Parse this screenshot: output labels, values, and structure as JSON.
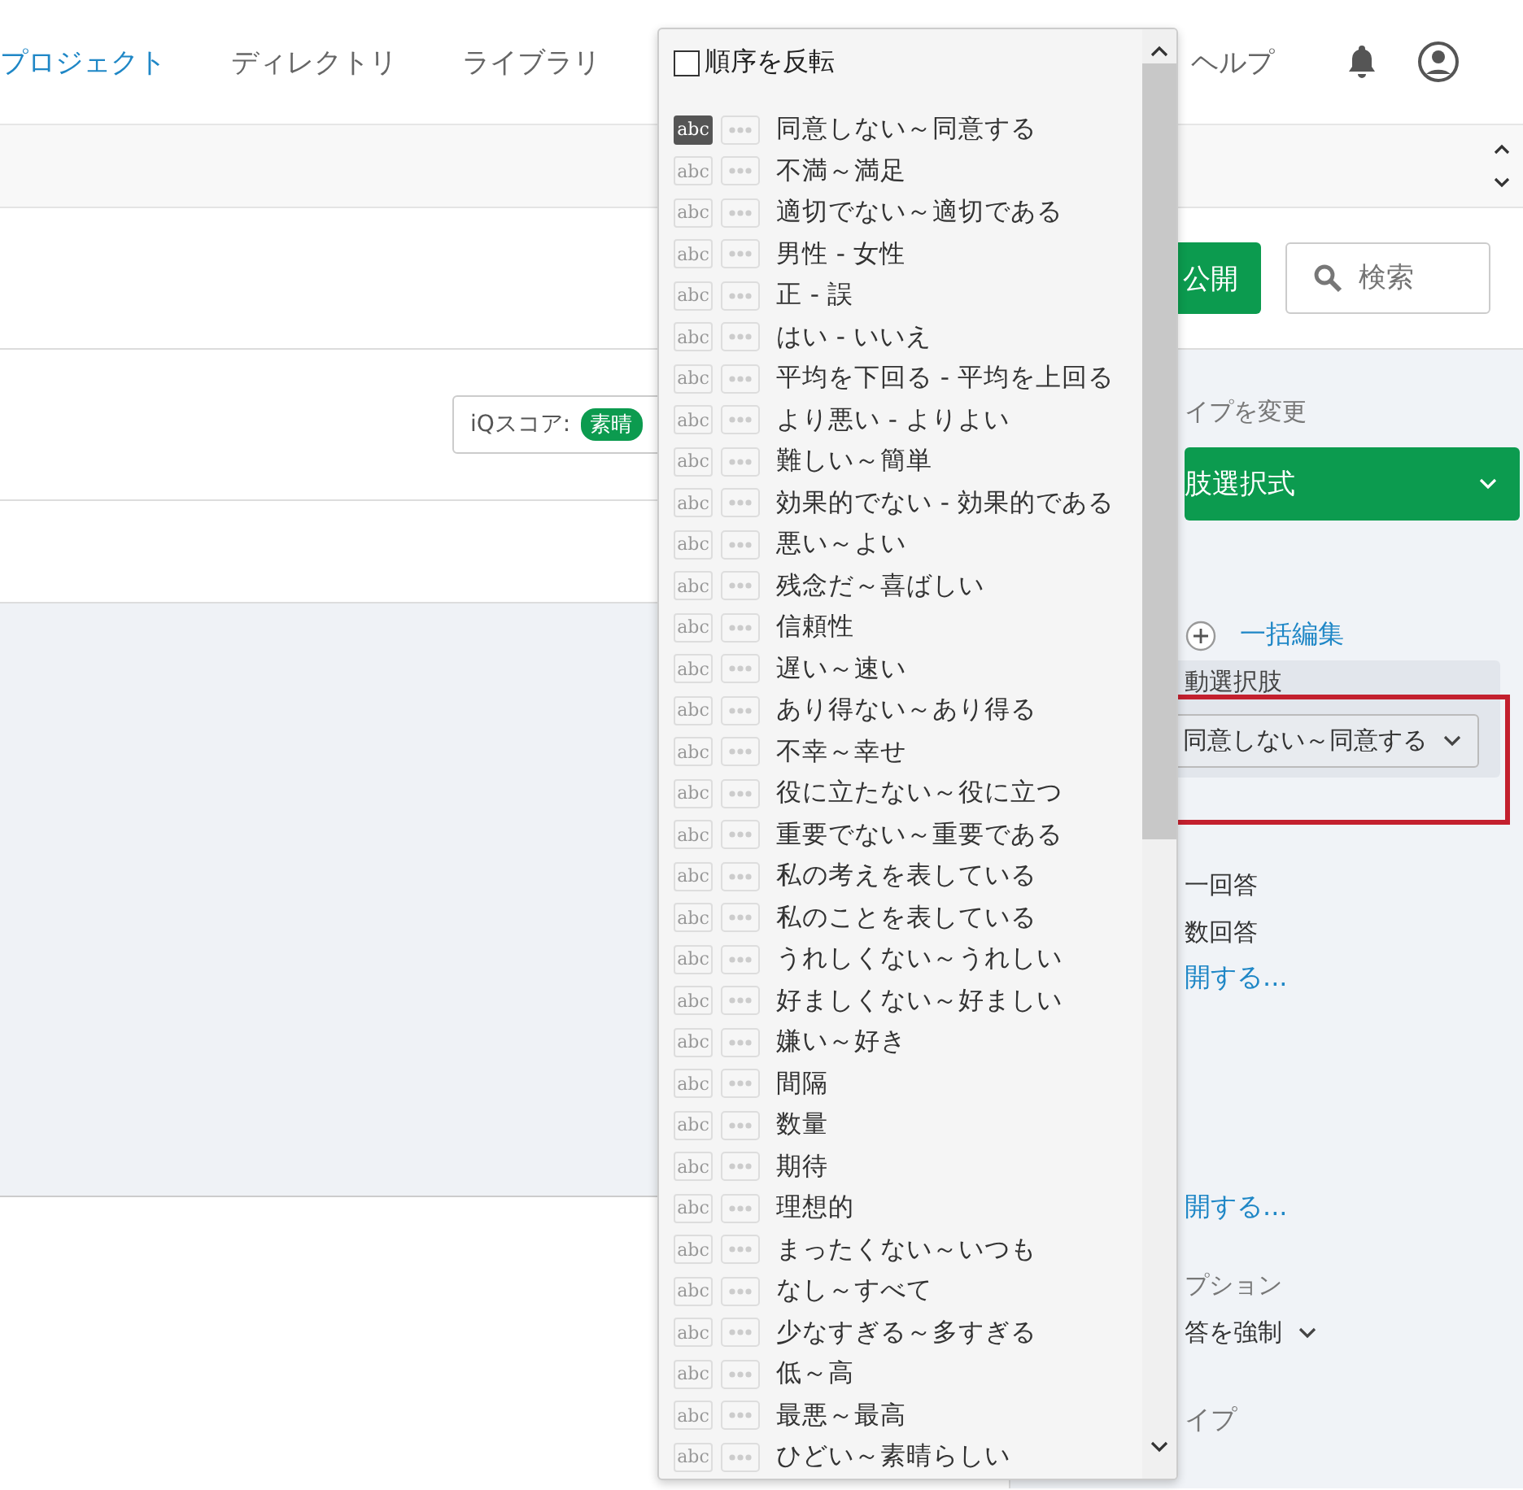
{
  "nav": {
    "items": [
      {
        "label": "プロジェクト",
        "selected": true
      },
      {
        "label": "ディレクトリ",
        "selected": false
      },
      {
        "label": "ライブラリ",
        "selected": false
      }
    ],
    "help": "ヘルプ"
  },
  "toolbar": {
    "publish": "公開",
    "search": {
      "placeholder": "検索"
    }
  },
  "iq": {
    "label": "iQスコア:",
    "badge": "素晴"
  },
  "dropdown": {
    "reverse": {
      "label": "順序を反転",
      "checked": false
    },
    "items": [
      {
        "tag": "abc",
        "label": "同意しない～同意する",
        "selected": true
      },
      {
        "tag": "abc",
        "label": "不満～満足",
        "selected": false
      },
      {
        "tag": "abc",
        "label": "適切でない～適切である",
        "selected": false
      },
      {
        "tag": "abc",
        "label": "男性 - 女性",
        "selected": false
      },
      {
        "tag": "abc",
        "label": "正 - 誤",
        "selected": false
      },
      {
        "tag": "abc",
        "label": "はい - いいえ",
        "selected": false
      },
      {
        "tag": "abc",
        "label": "平均を下回る - 平均を上回る",
        "selected": false
      },
      {
        "tag": "abc",
        "label": "より悪い - よりよい",
        "selected": false
      },
      {
        "tag": "abc",
        "label": "難しい～簡単",
        "selected": false
      },
      {
        "tag": "abc",
        "label": "効果的でない - 効果的である",
        "selected": false
      },
      {
        "tag": "abc",
        "label": "悪い～よい",
        "selected": false
      },
      {
        "tag": "abc",
        "label": "残念だ～喜ばしい",
        "selected": false
      },
      {
        "tag": "abc",
        "label": "信頼性",
        "selected": false
      },
      {
        "tag": "abc",
        "label": "遅い～速い",
        "selected": false
      },
      {
        "tag": "abc",
        "label": "あり得ない～あり得る",
        "selected": false
      },
      {
        "tag": "abc",
        "label": "不幸～幸せ",
        "selected": false
      },
      {
        "tag": "abc",
        "label": "役に立たない～役に立つ",
        "selected": false
      },
      {
        "tag": "abc",
        "label": "重要でない～重要である",
        "selected": false
      },
      {
        "tag": "abc",
        "label": "私の考えを表している",
        "selected": false
      },
      {
        "tag": "abc",
        "label": "私のことを表している",
        "selected": false
      },
      {
        "tag": "abc",
        "label": "うれしくない～うれしい",
        "selected": false
      },
      {
        "tag": "abc",
        "label": "好ましくない～好ましい",
        "selected": false
      },
      {
        "tag": "abc",
        "label": "嫌い～好き",
        "selected": false
      },
      {
        "tag": "abc",
        "label": "間隔",
        "selected": false
      },
      {
        "tag": "abc",
        "label": "数量",
        "selected": false
      },
      {
        "tag": "abc",
        "label": "期待",
        "selected": false
      },
      {
        "tag": "abc",
        "label": "理想的",
        "selected": false
      },
      {
        "tag": "abc",
        "label": "まったくない～いつも",
        "selected": false
      },
      {
        "tag": "abc",
        "label": "なし～すべて",
        "selected": false
      },
      {
        "tag": "abc",
        "label": "少なすぎる～多すぎる",
        "selected": false
      },
      {
        "tag": "abc",
        "label": "低～高",
        "selected": false
      },
      {
        "tag": "abc",
        "label": "最悪～最高",
        "selected": false
      },
      {
        "tag": "abc",
        "label": "ひどい～素晴らしい",
        "selected": false
      }
    ]
  },
  "sidebar": {
    "change_type_label": "イプを変更",
    "type_select": "肢選択式",
    "bulk_edit": "一括編集",
    "auto_choices_label": "動選択肢",
    "choices_select": "同意しない～同意する",
    "answer_options": [
      "一回答",
      "数回答"
    ],
    "expand_link_1": "開する...",
    "expand_link_2": "開する...",
    "options_heading": "プション",
    "force_answer": "答を強制",
    "type_heading": "イプ"
  }
}
